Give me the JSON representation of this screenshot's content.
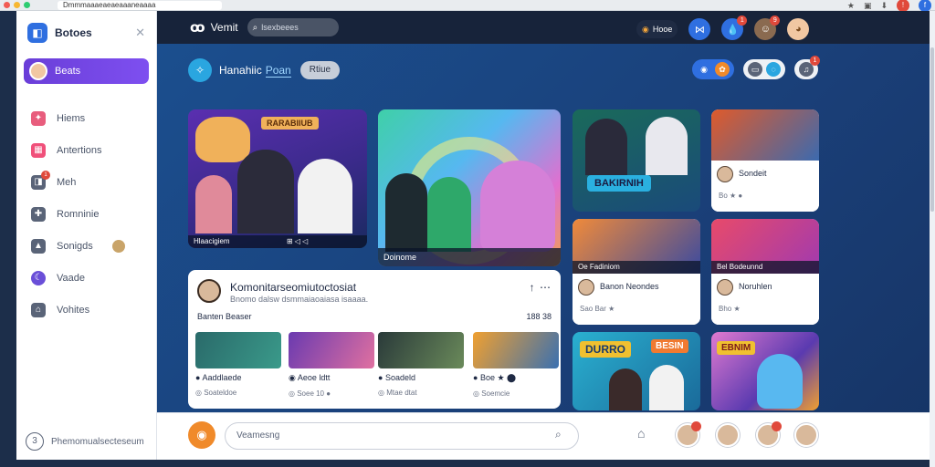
{
  "browser": {
    "url": "Dmmmaaaeaeaeaaaneaaaa",
    "colors": {
      "close": "#f25c54",
      "min": "#f7b731",
      "max": "#2ecc71"
    }
  },
  "sidebar": {
    "title": "Botoes",
    "active_item": "Beats",
    "items": [
      {
        "label": "Hiems",
        "icon": "star-icon"
      },
      {
        "label": "Antertions",
        "icon": "calendar-icon"
      },
      {
        "label": "Meh",
        "icon": "chat-icon",
        "badge": "1"
      },
      {
        "label": "Romninie",
        "icon": "puzzle-icon"
      },
      {
        "label": "Sonigds",
        "icon": "mountain-icon"
      },
      {
        "label": "Vaade",
        "icon": "moon-icon"
      },
      {
        "label": "Vohites",
        "icon": "house-icon"
      }
    ],
    "footer": {
      "icon_text": "3",
      "label": "Phemomualsecteseum"
    }
  },
  "topbar": {
    "brand": "Vemit",
    "search_text": "lsexbeees",
    "pill_text": "Hooe",
    "badges": [
      "1",
      "9"
    ]
  },
  "subhead": {
    "title": "Hanahiic",
    "link": "Poan",
    "button": "Rtiue",
    "right_badge": "1"
  },
  "cards": {
    "c1_caption": "Hlaacigiem",
    "c1_meta": "⊞ ◁ ◁",
    "c1_banner": "RARABIIUB",
    "c2_caption": "Doinome",
    "c3_banner": "BAKIRNIH",
    "c4_title": "Sondeit",
    "c4_meta": "Bo ★ ●",
    "c5_caption": "Oe Fadiniom",
    "c5_title": "Banon Neondes",
    "c5_meta": "Sao Bar ★",
    "c6_caption": "Bel Bodeunnd",
    "c6_title": "Noruhlen",
    "c6_meta": "Bho ★",
    "c7_banner": "DURRO",
    "c7_banner2": "BESIN",
    "c8_banner": "EBNIM"
  },
  "feature": {
    "title": "Komonitarseomiutoctosiat",
    "subtitle": "Bnomo dalsw dsmmaiaoaiasa isaaaa.",
    "more": "⋯",
    "meta_left": "Banten Beaser",
    "meta_right": "188 38",
    "minis": [
      {
        "title": "Aaddlaede",
        "meta": "Soateldoe"
      },
      {
        "title": "Aeoe ldtt",
        "meta": "Soee   10   ●"
      },
      {
        "title": "Soadeld",
        "meta": "Mtae dtat"
      },
      {
        "title": "Boe ★ ⬤",
        "meta": "Soemcie"
      }
    ]
  },
  "bottombar": {
    "input_placeholder": "Veamesng"
  }
}
